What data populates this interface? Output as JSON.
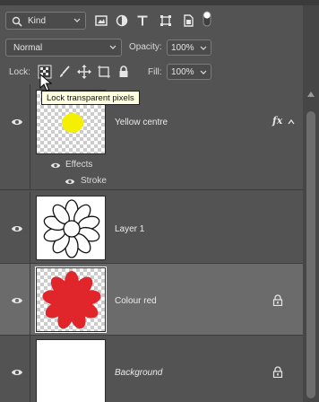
{
  "filter_row": {
    "kind_label": "Kind",
    "filter_icons": [
      "image-filter-icon",
      "adjustment-filter-icon",
      "type-filter-icon",
      "shape-filter-icon",
      "smart-object-filter-icon",
      "filter-toggle-icon"
    ]
  },
  "blend_row": {
    "blend_mode": "Normal",
    "opacity_label": "Opacity:",
    "opacity_value": "100%"
  },
  "lock_row": {
    "lock_label": "Lock:",
    "fill_label": "Fill:",
    "fill_value": "100%",
    "tooltip": "Lock transparent pixels"
  },
  "layers": [
    {
      "name": "Yellow centre",
      "visible": true,
      "has_fx": true,
      "fx_label": "fx",
      "effects_label": "Effects",
      "effects": [
        "Stroke"
      ]
    },
    {
      "name": "Layer 1",
      "visible": true
    },
    {
      "name": "Colour red",
      "visible": true,
      "selected": true,
      "locked": true
    },
    {
      "name": "Background",
      "visible": true,
      "locked": true,
      "italic": true
    }
  ],
  "colors": {
    "panel_bg": "#535353",
    "selected_bg": "#6b6b6b",
    "yellow": "#f5f000",
    "red": "#e0262b",
    "tooltip_bg": "#ffffe1"
  }
}
